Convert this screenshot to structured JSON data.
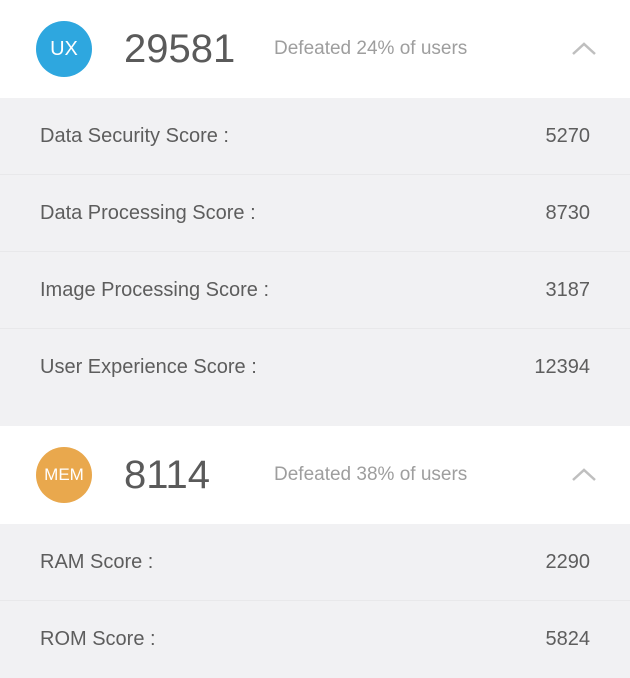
{
  "sections": [
    {
      "badge": "UX",
      "badgeClass": "badge-ux",
      "score": "29581",
      "defeat": "Defeated 24% of users",
      "metrics": [
        {
          "label": "Data Security Score :",
          "value": "5270"
        },
        {
          "label": "Data Processing Score :",
          "value": "8730"
        },
        {
          "label": "Image Processing Score :",
          "value": "3187"
        },
        {
          "label": "User Experience Score :",
          "value": "12394"
        }
      ]
    },
    {
      "badge": "MEM",
      "badgeClass": "badge-mem",
      "score": "8114",
      "defeat": "Defeated 38% of users",
      "metrics": [
        {
          "label": "RAM Score :",
          "value": "2290"
        },
        {
          "label": "ROM Score :",
          "value": "5824"
        }
      ]
    }
  ]
}
